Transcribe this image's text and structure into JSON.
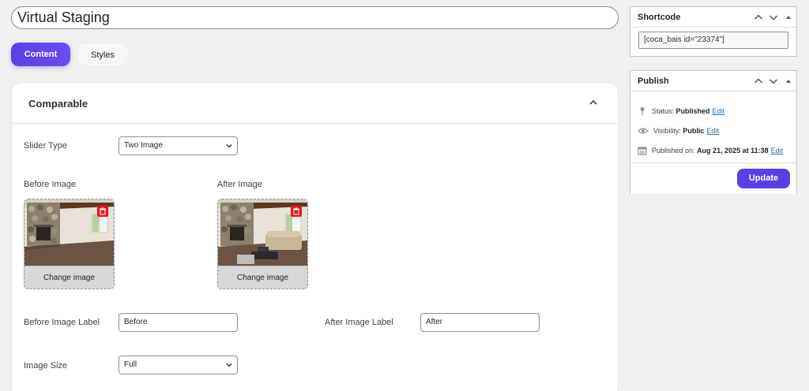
{
  "post_title": "Virtual Staging",
  "tabs": [
    {
      "label": "Content"
    },
    {
      "label": "Styles"
    }
  ],
  "section": {
    "title": "Comparable",
    "slider_type": {
      "label": "Slider Type",
      "value": "Two Image"
    },
    "before_image": {
      "label": "Before Image",
      "change_label": "Change image"
    },
    "after_image": {
      "label": "After Image",
      "change_label": "Change image"
    },
    "before_label": {
      "label": "Before Image Label",
      "value": "Before"
    },
    "after_label": {
      "label": "After Image Label",
      "value": "After"
    },
    "image_size": {
      "label": "Image Size",
      "value": "Full"
    }
  },
  "shortcode": {
    "title": "Shortcode",
    "value": "[coca_bais id=\"23374\"]"
  },
  "publish": {
    "title": "Publish",
    "status_label": "Status:",
    "status_value": "Published",
    "visibility_label": "Visibility:",
    "visibility_value": "Public",
    "published_label": "Published on:",
    "published_value": "Aug 21, 2025 at 11:38",
    "edit_label": "Edit",
    "update_label": "Update"
  },
  "colors": {
    "accent": "#5b3ee6",
    "delete": "#e8161e",
    "link": "#2271b1"
  },
  "icons": [
    "chevron-up-icon",
    "chevron-down-icon",
    "caret-up-icon",
    "pin-icon",
    "eye-icon",
    "calendar-icon",
    "trash-icon"
  ]
}
